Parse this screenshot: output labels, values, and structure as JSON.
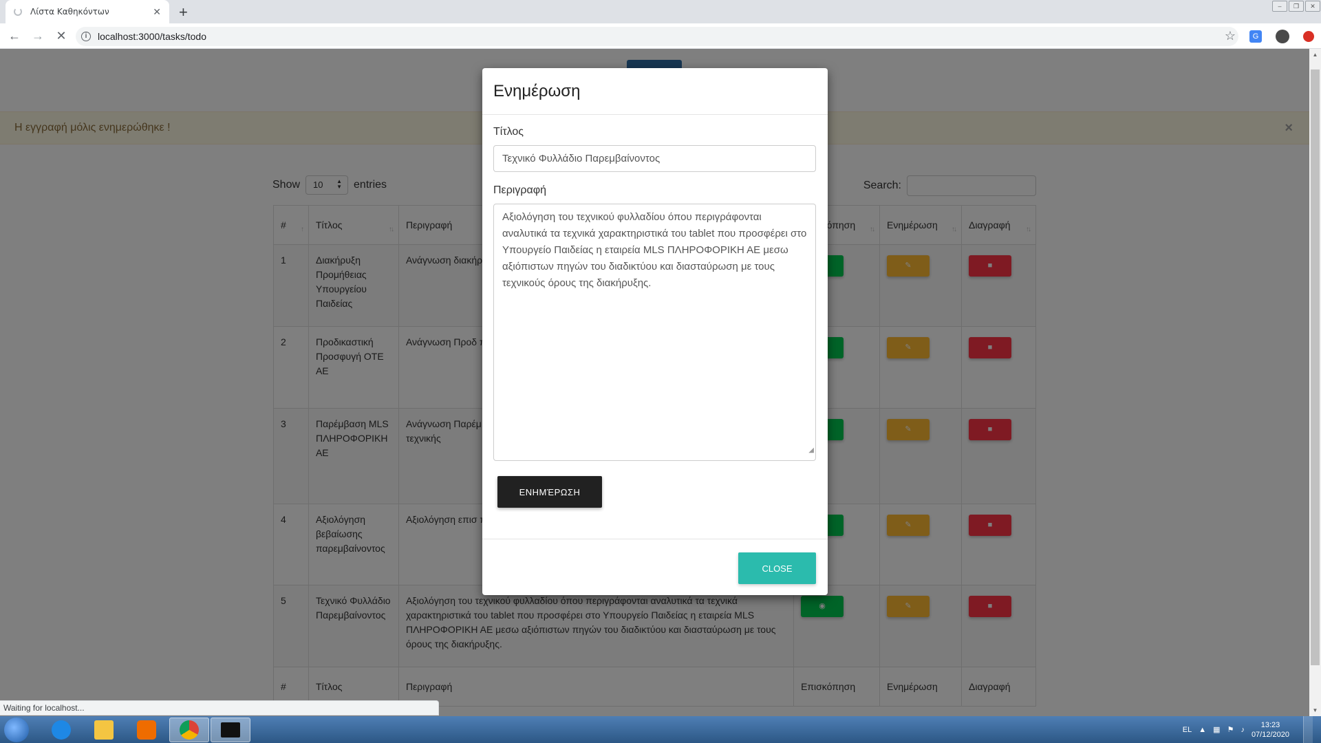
{
  "browser": {
    "tab_title": "Λίστα Καθηκόντων",
    "tab_close": "✕",
    "new_tab": "+",
    "url": "localhost:3000/tasks/todo",
    "status_text": "Waiting for localhost..."
  },
  "alert": {
    "message": "Η εγγραφή μόλις ενημερώθηκε !",
    "close": "×"
  },
  "datatable": {
    "show_label": "Show",
    "page_length": "10",
    "entries_label": "entries",
    "search_label": "Search:",
    "columns": [
      "#",
      "Τίτλος",
      "Περιγραφή",
      "Επισκόπηση",
      "Ενημέρωση",
      "Διαγραφή"
    ],
    "rows": [
      {
        "num": "1",
        "title": "Διακήρυξη Προμήθειας Υπουργείου Παιδείας",
        "description": "Ανάγνωση διακήρυξης πρωτοβάθμιας κ"
      },
      {
        "num": "2",
        "title": "Προδικαστική Προσφυγή ΟΤΕ ΑΕ",
        "description": "Ανάγνωση Προδ προμήθεια tablet ταχύτητα πυρήνω (Free Edition). Σε"
      },
      {
        "num": "3",
        "title": "Παρέμβαση MLS ΠΛΗΡΟΦΟΡΙΚΗ ΑΕ",
        "description": "Ανάγνωση Παρέμ τεχνικής της προσ επεξεργαστής κα Επίσης διερεύνησ χρήστες τεχνικής"
      },
      {
        "num": "4",
        "title": "Αξιολόγηση βεβαίωσης παρεμβαίνοντος",
        "description": "Αξιολόγηση επισ πυρήνων επεξεργ ΑΕ από αξιόπισ Notebookcheck,"
      },
      {
        "num": "5",
        "title": "Τεχνικό Φυλλάδιο Παρεμβαίνοντος",
        "description": "Αξιολόγηση του τεχνικού φυλλαδίου όπου περιγράφονται αναλυτικά τα τεχνικά χαρακτηριστικά του tablet που προσφέρει στο Υπουργείο Παιδείας η εταιρεία MLS ΠΛΗΡΟΦΟΡΙΚΗ ΑΕ μεσω αξιόπιστων πηγών του διαδικτύου και διασταύρωση με τους όρους της διακήρυξης."
      }
    ]
  },
  "modal": {
    "title": "Ενημέρωση",
    "title_label": "Τίτλος",
    "title_value": "Τεχνικό Φυλλάδιο Παρεμβαίνοντος",
    "description_label": "Περιγραφή",
    "description_value": "Αξιολόγηση του τεχνικού φυλλαδίου όπου περιγράφονται αναλυτικά τα τεχνικά χαρακτηριστικά του tablet που προσφέρει στο Υπουργείο Παιδείας η εταιρεία MLS ΠΛΗΡΟΦΟΡΙΚΗ ΑΕ μεσω αξιόπιστων πηγών του διαδικτύου και διασταύρωση με τους τεχνικούς όρους της διακήρυξης.",
    "submit_label": "ΕΝΗΜΈΡΩΣΗ",
    "close_label": "CLOSE"
  },
  "taskbar": {
    "language": "EL",
    "time": "13:23",
    "date": "07/12/2020"
  },
  "colors": {
    "view_button": "#00c851",
    "update_button": "#ffbb33",
    "delete_button": "#ff3547",
    "close_button": "#2bbbad",
    "submit_button": "#212121"
  },
  "icons": {
    "view": "eye-icon",
    "update": "edit-icon",
    "delete": "trash-icon"
  }
}
